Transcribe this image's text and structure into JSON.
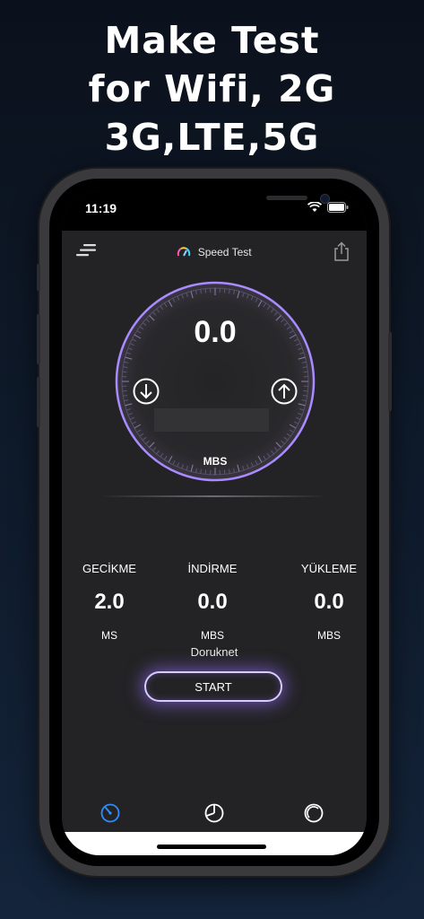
{
  "promo": {
    "line1": "Make Test",
    "line2": "for Wifi, 2G",
    "line3": "3G,LTE,5G"
  },
  "statusbar": {
    "time": "11:19",
    "icons": [
      "wifi-icon",
      "battery-icon"
    ]
  },
  "header": {
    "title": "Speed Test",
    "left_icon": "menu-icon",
    "right_icon": "share-icon"
  },
  "gauge": {
    "value": "0.0",
    "unit": "MBS",
    "down_icon": "download-arrow-icon",
    "up_icon": "upload-arrow-icon",
    "ring_color": "#a98bff"
  },
  "stats": [
    {
      "label": "GECİKME",
      "value": "2.0",
      "unit": "MS"
    },
    {
      "label": "İNDİRME",
      "value": "0.0",
      "unit": "MBS"
    },
    {
      "label": "YÜKLEME",
      "value": "0.0",
      "unit": "MBS"
    }
  ],
  "server": "Doruknet",
  "start_label": "START",
  "tabs": [
    {
      "icon": "speedometer-icon",
      "active": true,
      "color": "#2f8cff"
    },
    {
      "icon": "history-icon",
      "active": false,
      "color": "#ffffff"
    },
    {
      "icon": "settings-dial-icon",
      "active": false,
      "color": "#ffffff"
    }
  ]
}
